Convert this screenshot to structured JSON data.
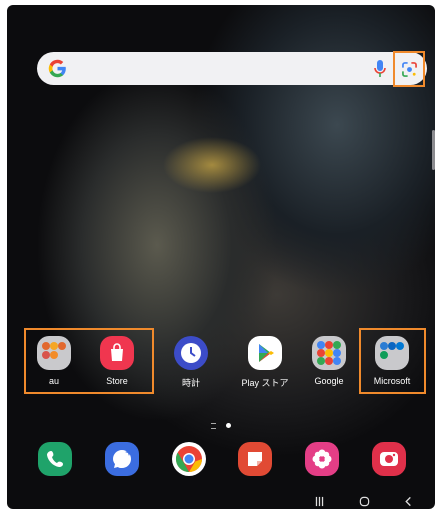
{
  "apps": [
    {
      "label": "au"
    },
    {
      "label": "Store"
    },
    {
      "label": "時計"
    },
    {
      "label": "Play ストア"
    },
    {
      "label": "Google"
    },
    {
      "label": "Microsoft"
    }
  ],
  "icons": {
    "search_bar": [
      "google-logo-icon",
      "microphone-icon",
      "google-lens-icon"
    ],
    "dock": [
      "phone-icon",
      "messages-icon",
      "chrome-icon",
      "notes-icon",
      "gallery-icon",
      "camera-icon"
    ],
    "nav": [
      "recents-icon",
      "home-icon",
      "back-icon"
    ]
  },
  "colors": {
    "highlight": "#f08a2c",
    "store": "#f0364f",
    "clock": "#3c4cc8",
    "phone": "#1fa36a",
    "messages": "#3b6de0",
    "notes": "#e14a34",
    "gallery": "#e43e86",
    "camera": "#e0304a"
  }
}
